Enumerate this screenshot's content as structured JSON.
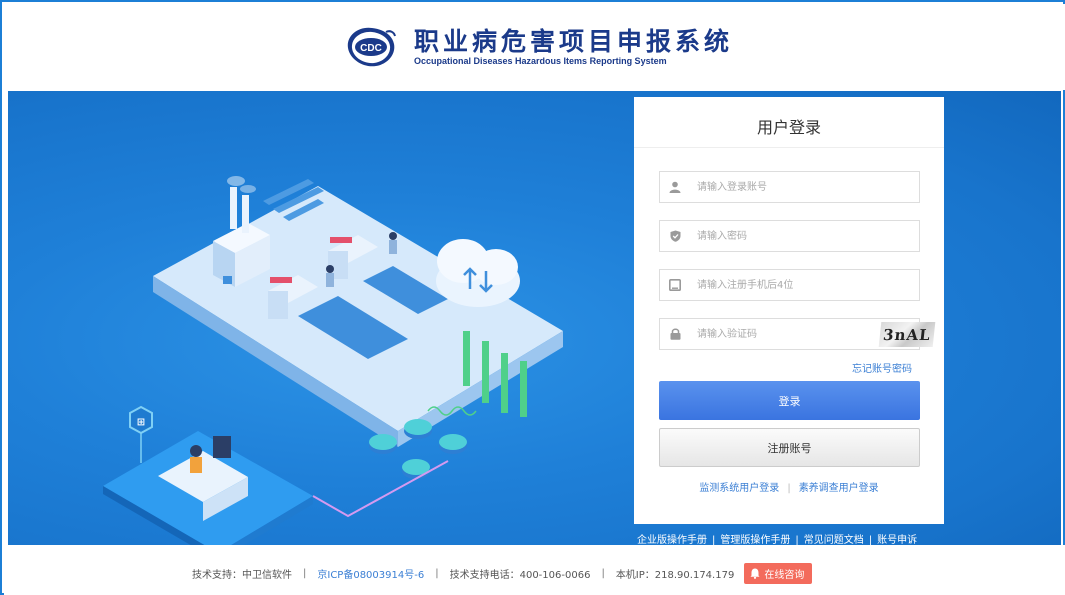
{
  "header": {
    "logo_text": "CDC",
    "title": "职业病危害项目申报系统",
    "subtitle": "Occupational Diseases Hazardous Items Reporting System"
  },
  "login": {
    "title": "用户登录",
    "account_placeholder": "请输入登录账号",
    "password_placeholder": "请输入密码",
    "phone_placeholder": "请输入注册手机后4位",
    "captcha_placeholder": "请输入验证码",
    "captcha_text": "3nAL",
    "forgot_link": "忘记账号密码",
    "login_button": "登录",
    "register_button": "注册账号",
    "alt_logins": [
      "监测系统用户登录",
      "素养调查用户登录"
    ],
    "icons": [
      "user-icon",
      "shield-icon",
      "phone-icon",
      "lock-icon"
    ]
  },
  "manual_links": [
    "企业版操作手册",
    "管理版操作手册",
    "常见问题文档",
    "账号申诉"
  ],
  "footer": {
    "tech_support": "技术支持：中卫信软件",
    "icp": "京ICP备08003914号-6",
    "phone": "技术支持电话：400-106-0066",
    "ip": "本机IP：218.90.174.179",
    "consult_button": "在线咨询"
  },
  "colors": {
    "frame": "#1c7fd6",
    "banner": "#1a7bd4",
    "title": "#1b3a8a",
    "link": "#3b7fd4",
    "login_button": "#4a84e8",
    "consult_button": "#f36b5c"
  }
}
